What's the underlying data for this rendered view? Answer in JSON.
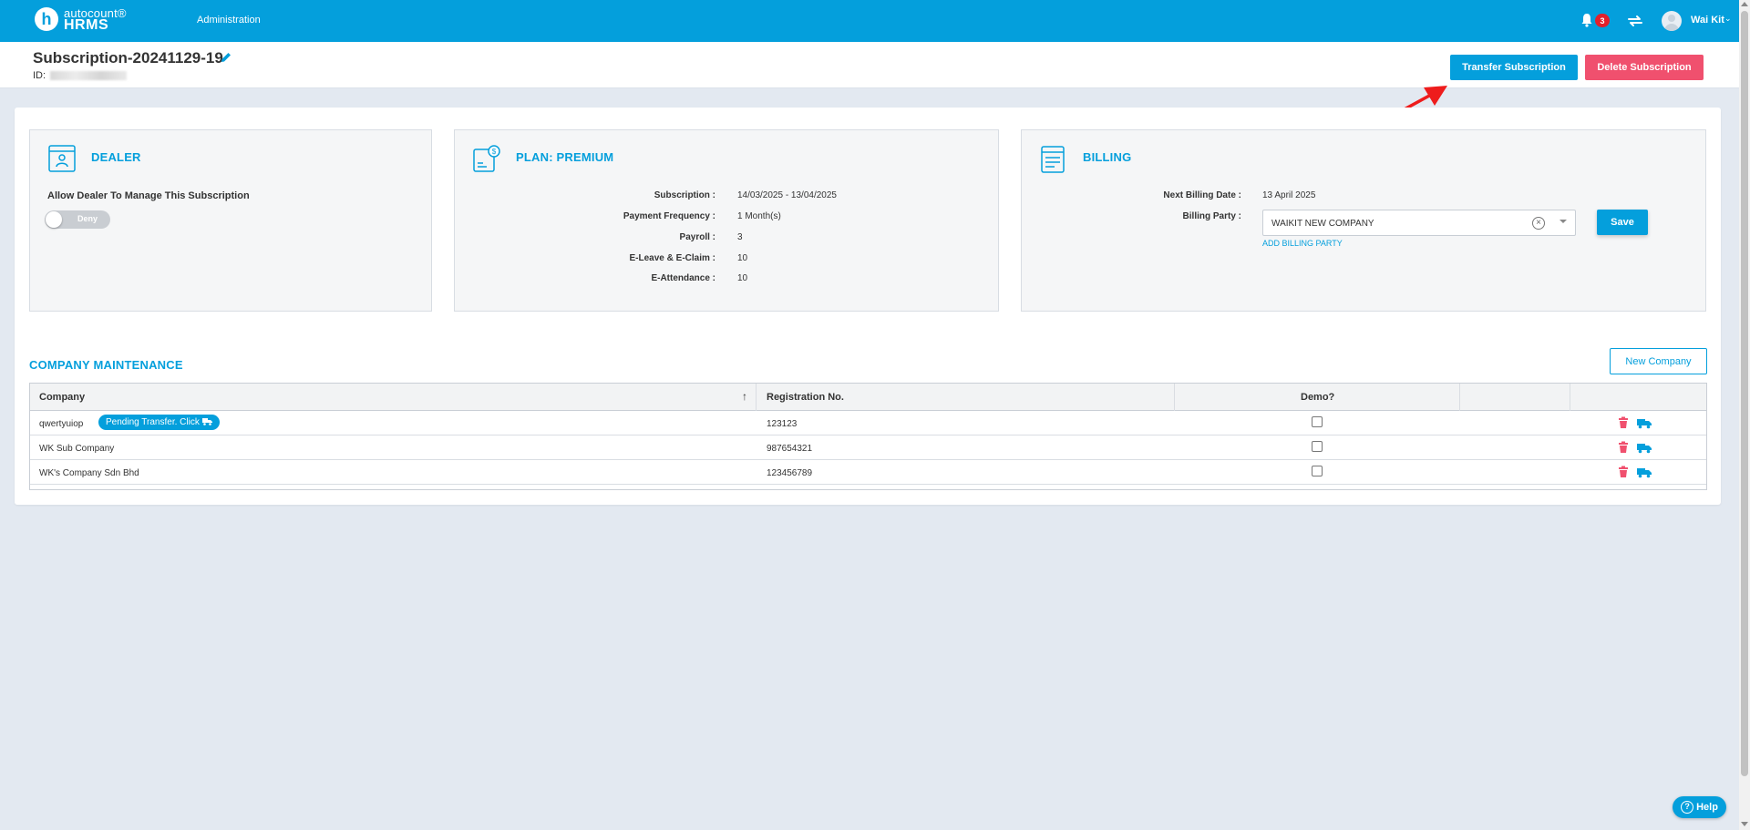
{
  "app": {
    "logo_top": "autocount®",
    "logo_bottom": "HRMS",
    "logo_letter": "h",
    "nav_admin": "Administration",
    "notification_count": "3",
    "user_name": "Wai Kit",
    "accent_color": "#049fdc"
  },
  "header": {
    "title": "Subscription-20241129-19",
    "id_label": "ID:",
    "transfer_label": "Transfer Subscription",
    "delete_label": "Delete Subscription"
  },
  "dealer": {
    "title": "DEALER",
    "allow_label": "Allow Dealer To Manage This Subscription",
    "toggle_text": "Deny",
    "toggle_on": false
  },
  "plan": {
    "title": "PLAN: PREMIUM",
    "rows": [
      {
        "label": "Subscription :",
        "value": "14/03/2025 - 13/04/2025"
      },
      {
        "label": "Payment Frequency :",
        "value": "1 Month(s)"
      },
      {
        "label": "Payroll :",
        "value": "3"
      },
      {
        "label": "E-Leave & E-Claim :",
        "value": "10"
      },
      {
        "label": "E-Attendance :",
        "value": "10"
      }
    ]
  },
  "billing": {
    "title": "BILLING",
    "next_date_label": "Next Billing Date :",
    "next_date_value": "13 April 2025",
    "party_label": "Billing Party :",
    "party_value": "WAIKIT NEW COMPANY",
    "add_party_label": "ADD BILLING PARTY",
    "save_label": "Save"
  },
  "company": {
    "title": "COMPANY MAINTENANCE",
    "new_label": "New Company",
    "columns": [
      "Company",
      "Registration No.",
      "Demo?"
    ],
    "rows": [
      {
        "name": "qwertyuiop",
        "pending": "Pending Transfer. Click",
        "reg": "123123",
        "demo": false
      },
      {
        "name": "WK Sub Company",
        "pending": "",
        "reg": "987654321",
        "demo": false
      },
      {
        "name": "WK's Company Sdn Bhd",
        "pending": "",
        "reg": "123456789",
        "demo": false
      }
    ]
  },
  "help": {
    "label": "Help"
  },
  "icons": {
    "bell": "bell-icon",
    "sync": "sync-icon",
    "edit": "pencil-icon",
    "delete": "trash-icon",
    "transfer": "truck-icon",
    "sort": "sort-arrow-icon"
  }
}
